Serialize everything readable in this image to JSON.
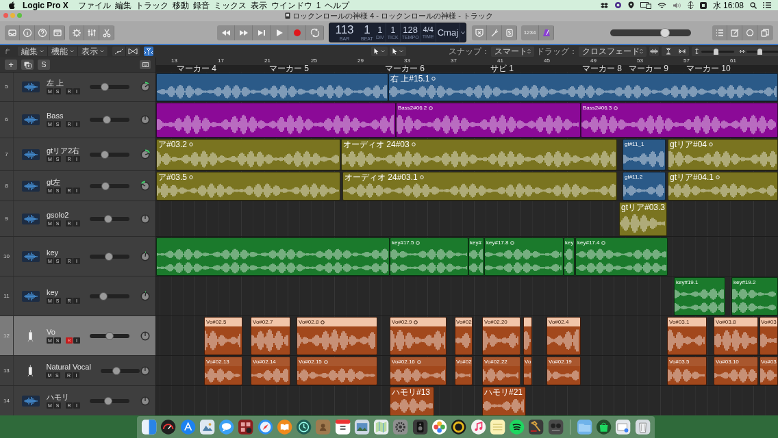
{
  "menu_bar": {
    "app": "Logic Pro X",
    "menus": [
      "ファイル",
      "編集",
      "トラック",
      "移動",
      "録音",
      "ミックス",
      "表示",
      "ウインドウ",
      "1",
      "ヘルプ"
    ],
    "clock": "水 16:08"
  },
  "window": {
    "title": "ロックンロールの神様 4 - ロックンロールの神様 - トラック"
  },
  "lcd": {
    "fields": [
      {
        "value": "113",
        "label": "BAR"
      },
      {
        "value": "1",
        "label": "BEAT"
      },
      {
        "value": "1",
        "label": "DIV"
      },
      {
        "value": "1",
        "label": "TICK"
      },
      {
        "value": "128",
        "label": "TEMPO"
      },
      {
        "value": "4/4",
        "label": "TIME"
      },
      {
        "value": "Cmaj"
      }
    ]
  },
  "count_in": "1234",
  "master_volume": {
    "level": 0.7
  },
  "toolbar": {
    "menus": [
      "編集",
      "機能",
      "表示"
    ],
    "catch": {
      "on": true
    },
    "snap": {
      "label": "スナップ：",
      "value": "スマート"
    },
    "drag": {
      "label": "ドラッグ：",
      "value": "クロスフェード"
    },
    "vertical_zoom": {
      "level": 0.45
    },
    "horizontal_zoom": {
      "level": 0.4
    }
  },
  "track_header": {
    "add": "+",
    "solo": "S"
  },
  "ruler": {
    "bars": [
      "13",
      "17",
      "21",
      "25",
      "29",
      "33",
      "37",
      "41",
      "45",
      "49",
      "53",
      "57",
      "61"
    ],
    "markers": [
      "マーカー 4",
      "マーカー 5",
      "マーカー 6",
      "サビ 1",
      "マーカー 8",
      "マーカー 9",
      "マーカー 10"
    ]
  },
  "tracks": [
    {
      "number": "5",
      "name": "左 上",
      "kind": "audio",
      "selected": false,
      "record": false,
      "controls": [
        "M",
        "S",
        "R",
        "I"
      ],
      "volume": {
        "level": 0.35
      },
      "regions": [
        {
          "color": "#2b5a88"
        },
        {
          "label": "右 上#15.1",
          "color": "#2b5a88"
        }
      ]
    },
    {
      "number": "6",
      "name": "Bass",
      "kind": "audio",
      "selected": false,
      "record": false,
      "controls": [
        "M",
        "S",
        "R",
        "I"
      ],
      "volume": {
        "level": 0.42
      },
      "regions": [
        {
          "color": "#8b0a97"
        },
        {
          "label": "Bass2#06.2",
          "color": "#8b0a97"
        },
        {
          "label": "Bass2#06.3",
          "color": "#8b0a97"
        }
      ]
    },
    {
      "number": "7",
      "name": "gtリア2右",
      "kind": "audio",
      "selected": false,
      "record": false,
      "controls": [
        "M",
        "S",
        "R",
        "I"
      ],
      "volume": {
        "level": 0.35
      },
      "regions": [
        {
          "label": "ア#03.2",
          "color": "#7a7420"
        },
        {
          "label": "オーディオ 24#03",
          "color": "#7a7420"
        },
        {
          "label": "gt#11_1",
          "color": "#2b5a88"
        },
        {
          "label": "gtリア#04",
          "color": "#7a7420"
        }
      ]
    },
    {
      "number": "8",
      "name": "gt左",
      "kind": "audio",
      "selected": false,
      "record": false,
      "controls": [
        "M",
        "S",
        "R",
        "I"
      ],
      "volume": {
        "level": 0.38
      },
      "regions": [
        {
          "label": "ア#03.5",
          "color": "#7a7420"
        },
        {
          "label": "オーディオ 24#03.1",
          "color": "#7a7420"
        },
        {
          "label": "gt#11.2",
          "color": "#2b5a88"
        },
        {
          "label": "gtリア#04.1",
          "color": "#7a7420"
        }
      ]
    },
    {
      "number": "9",
      "name": "gsolo2",
      "kind": "audio",
      "selected": false,
      "record": false,
      "controls": [
        "M",
        "S",
        "R",
        "I"
      ],
      "volume": {
        "level": 0.45
      },
      "regions": [
        {
          "label": "gtリア#03.3",
          "color": "#7a7420"
        }
      ]
    },
    {
      "number": "10",
      "name": "key",
      "kind": "stereo",
      "selected": false,
      "record": false,
      "controls": [
        "M",
        "S",
        "R",
        "I"
      ],
      "volume": {
        "level": 0.48
      },
      "regions": [
        {
          "color": "#1b7a2c"
        },
        {
          "label": "key#17.5",
          "color": "#1b7a2c"
        },
        {
          "label": "key#",
          "color": "#1b7a2c"
        },
        {
          "label": "key#17.8",
          "color": "#1b7a2c"
        },
        {
          "label": "key",
          "color": "#1b7a2c"
        },
        {
          "label": "key#17.4",
          "color": "#1b7a2c"
        }
      ]
    },
    {
      "number": "11",
      "name": "key",
      "kind": "stereo",
      "selected": false,
      "record": false,
      "controls": [
        "M",
        "S",
        "R",
        "I"
      ],
      "volume": {
        "level": 0.3
      },
      "regions": [
        {
          "label": "key#19.1",
          "color": "#1b7a2c"
        },
        {
          "label": "key#19.2",
          "color": "#1b7a2c"
        }
      ]
    },
    {
      "number": "12",
      "name": "Vo",
      "kind": "mic",
      "selected": true,
      "record": true,
      "controls": [
        "M",
        "S",
        "R",
        "I"
      ],
      "volume": {
        "level": 0.5
      },
      "regions": [
        {
          "label": "Vo#02.5",
          "color": "#a2481c"
        },
        {
          "label": "Vo#02.7",
          "color": "#a2481c"
        },
        {
          "label": "Vo#02.8",
          "color": "#a2481c"
        },
        {
          "label": "Vo#02.9",
          "color": "#a2481c"
        },
        {
          "label": "Vo#02",
          "color": "#a2481c"
        },
        {
          "label": "Vo#02.20",
          "color": "#a2481c"
        },
        {
          "color": "#a2481c"
        },
        {
          "label": "Vo#02.4",
          "color": "#a2481c"
        },
        {
          "label": "Vo#03.1",
          "color": "#a2481c"
        },
        {
          "label": "Vo#03.8",
          "color": "#a2481c"
        },
        {
          "label": "Vo#03",
          "color": "#a2481c"
        }
      ]
    },
    {
      "number": "13",
      "name": "Natural Vocal",
      "kind": "mic",
      "selected": false,
      "record": false,
      "controls": [
        "M",
        "S",
        "R",
        "I"
      ],
      "volume": {
        "level": 0.38
      },
      "regions": [
        {
          "label": "Vo#02.13",
          "color": "#a2481c"
        },
        {
          "label": "Vo#02.14",
          "color": "#a2481c"
        },
        {
          "label": "Vo#02.15",
          "color": "#a2481c"
        },
        {
          "label": "Vo#02.16",
          "color": "#a2481c"
        },
        {
          "label": "Vo#02",
          "color": "#a2481c"
        },
        {
          "label": "Vo#02.22",
          "color": "#a2481c"
        },
        {
          "label": "Vo",
          "color": "#a2481c"
        },
        {
          "label": "Vo#02.19",
          "color": "#a2481c"
        },
        {
          "label": "Vo#03.5",
          "color": "#a2481c"
        },
        {
          "label": "Vo#03.10",
          "color": "#a2481c"
        },
        {
          "label": "Vo#03",
          "color": "#a2481c"
        }
      ]
    },
    {
      "number": "14",
      "name": "ハモリ",
      "kind": "audio",
      "selected": false,
      "record": false,
      "controls": [
        "M",
        "S",
        "R",
        "I"
      ],
      "volume": {
        "level": 0.45
      },
      "regions": [
        {
          "label": "ハモリ#13",
          "color": "#a2481c"
        },
        {
          "label": "ハモリ#21",
          "color": "#a2481c"
        }
      ]
    }
  ]
}
